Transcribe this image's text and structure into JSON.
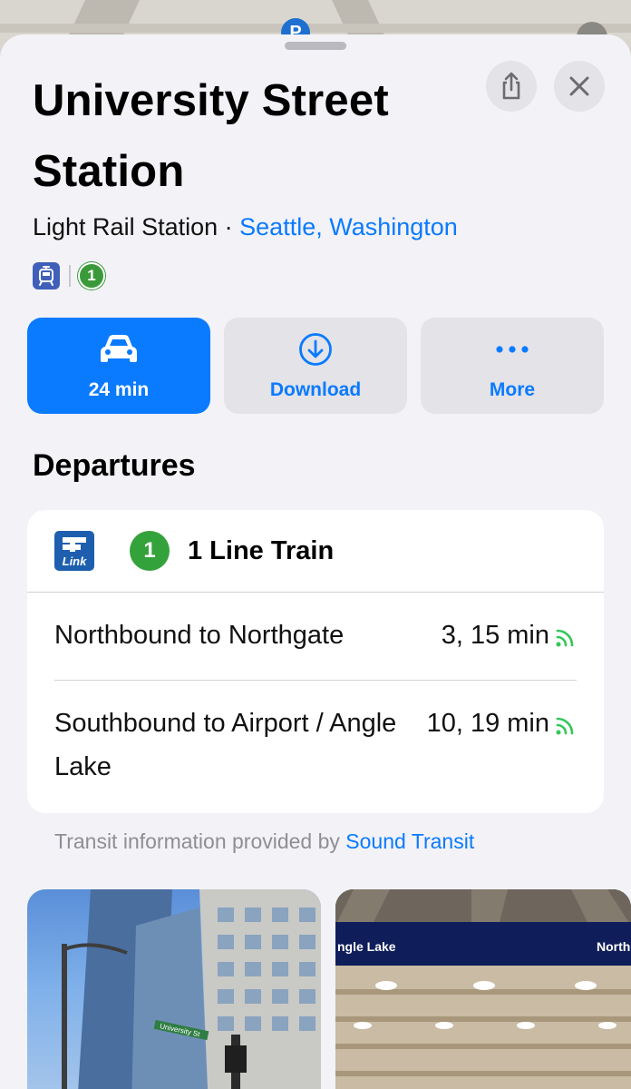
{
  "map": {
    "pin_label": "P"
  },
  "header": {
    "title": "University Street Station",
    "category": "Light Rail Station",
    "separator": "·",
    "location": "Seattle, Washington",
    "line_badge": "1",
    "share_icon": "share-icon",
    "close_icon": "close-icon"
  },
  "actions": [
    {
      "label": "24 min",
      "icon": "car-icon"
    },
    {
      "label": "Download",
      "icon": "download-icon"
    },
    {
      "label": "More",
      "icon": "ellipsis-icon"
    }
  ],
  "departures": {
    "heading": "Departures",
    "line": {
      "logo_text": "Link",
      "badge": "1",
      "name": "1 Line Train"
    },
    "rows": [
      {
        "destination": "Northbound to Northgate",
        "times": "3, 15 min"
      },
      {
        "destination": "Southbound to Airport / Angle Lake",
        "times": "10, 19 min"
      }
    ]
  },
  "credit": {
    "prefix": "Transit information provided by",
    "provider": "Sound Transit"
  },
  "photos": {
    "photo1_sign": "University St",
    "photo2_sign_left": "ngle Lake",
    "photo2_sign_right": "North"
  },
  "colors": {
    "accent": "#0a7aff",
    "line_green": "#34a23b",
    "realtime_green": "#34c759",
    "sheet_bg": "#f2f2f7"
  }
}
